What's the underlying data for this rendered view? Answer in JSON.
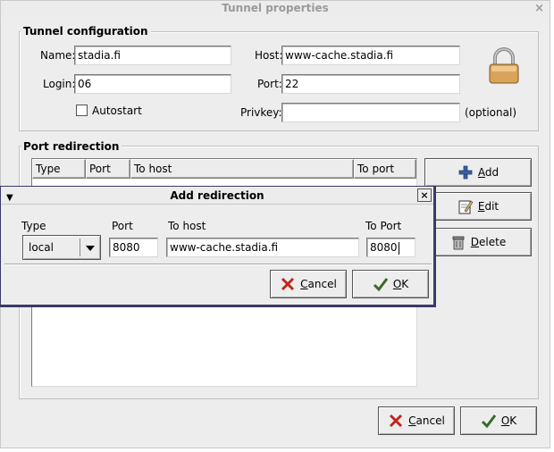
{
  "window": {
    "title": "Tunnel properties",
    "close": "×"
  },
  "tunnel": {
    "group_label": "Tunnel configuration",
    "name_label": "Name:",
    "name_value": "stadia.fi",
    "login_label": "Login:",
    "login_value": "06",
    "autostart_label": "Autostart",
    "host_label": "Host:",
    "host_value": "www-cache.stadia.fi",
    "port_label": "Port:",
    "port_value": "22",
    "privkey_label": "Privkey:",
    "privkey_value": "",
    "privkey_hint": "(optional)",
    "lock_icon": "padlock-icon"
  },
  "redirection": {
    "group_label": "Port redirection",
    "columns": [
      "Type",
      "Port",
      "To host",
      "To port"
    ],
    "add": {
      "mnemonic": "A",
      "rest": "dd"
    },
    "edit": {
      "mnemonic": "E",
      "rest": "dit"
    },
    "delete": {
      "mnemonic": "D",
      "rest": "elete"
    }
  },
  "dialog": {
    "title": "Add redirection",
    "close": "×",
    "type_label": "Type",
    "type_value": "local",
    "port_label": "Port",
    "port_value": "8080",
    "tohost_label": "To host",
    "tohost_value": "www-cache.stadia.fi",
    "toport_label": "To Port",
    "toport_value": "8080",
    "cancel": {
      "mnemonic": "C",
      "rest": "ancel"
    },
    "ok": {
      "mnemonic": "O",
      "rest": "K"
    }
  },
  "footer": {
    "cancel": {
      "mnemonic": "C",
      "rest": "ancel"
    },
    "ok": {
      "mnemonic": "O",
      "rest": "K"
    }
  },
  "colors": {
    "cancel_x": "#c0261c",
    "ok_check": "#3a6a2a",
    "dialog_border": "#3a3a6a"
  }
}
